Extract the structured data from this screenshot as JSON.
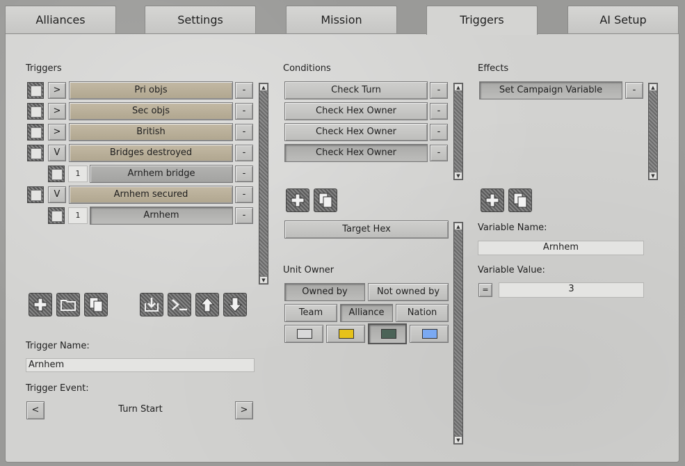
{
  "tabs": [
    {
      "label": "Alliances"
    },
    {
      "label": "Settings"
    },
    {
      "label": "Mission"
    },
    {
      "label": "Triggers"
    },
    {
      "label": "AI Setup"
    }
  ],
  "active_tab": "Triggers",
  "triggers": {
    "heading": "Triggers",
    "rows": [
      {
        "expand": ">",
        "label": "Pri objs",
        "remove": "-"
      },
      {
        "expand": ">",
        "label": "Sec objs",
        "remove": "-"
      },
      {
        "expand": ">",
        "label": "British",
        "remove": "-"
      },
      {
        "expand": "V",
        "label": "Bridges destroyed",
        "remove": "-"
      },
      {
        "count": "1",
        "label": "Arnhem bridge",
        "remove": "-"
      },
      {
        "expand": "V",
        "label": "Arnhem secured",
        "remove": "-"
      },
      {
        "count": "1",
        "label": "Arnhem",
        "remove": "-"
      }
    ],
    "icons": [
      "add-icon",
      "folder-icon",
      "copy-icon",
      "import-icon",
      "console-icon",
      "arrow-up-icon",
      "arrow-down-icon"
    ],
    "name_label": "Trigger Name:",
    "name_value": "Arnhem",
    "event_label": "Trigger Event:",
    "event_prev": "<",
    "event_value": "Turn Start",
    "event_next": ">"
  },
  "conditions": {
    "heading": "Conditions",
    "rows": [
      {
        "label": "Check Turn",
        "remove": "-"
      },
      {
        "label": "Check Hex Owner",
        "remove": "-"
      },
      {
        "label": "Check Hex Owner",
        "remove": "-"
      },
      {
        "label": "Check Hex Owner",
        "remove": "-"
      }
    ],
    "icons": [
      "add-icon",
      "copy-icon"
    ],
    "target_button": "Target Hex",
    "unit_owner_label": "Unit Owner",
    "owned_by": "Owned by",
    "not_owned_by": "Not owned by",
    "team": "Team",
    "alliance": "Alliance",
    "nation": "Nation",
    "colors": [
      "#d9d9d9",
      "#e6c21a",
      "#4b6357",
      "#7aa9f2"
    ]
  },
  "effects": {
    "heading": "Effects",
    "rows": [
      {
        "label": "Set Campaign Variable",
        "remove": "-"
      }
    ],
    "icons": [
      "add-icon",
      "copy-icon"
    ],
    "var_name_label": "Variable Name:",
    "var_name_value": "Arnhem",
    "var_value_label": "Variable Value:",
    "operator": "=",
    "var_value": "3"
  },
  "scroll_arrows": {
    "up": "▲",
    "down": "▼"
  }
}
